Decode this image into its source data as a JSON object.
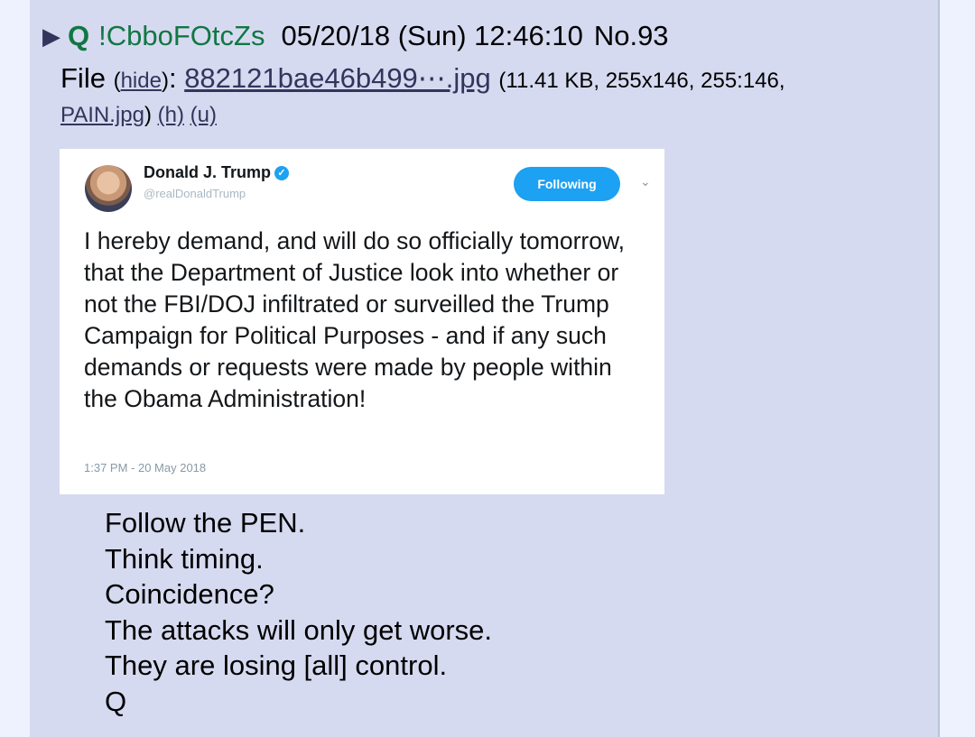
{
  "post": {
    "arrow": "▶",
    "name": "Q",
    "tripcode": "!CbboFOtcZs",
    "datetime": "05/20/18 (Sun) 12:46:10",
    "number": "No.93"
  },
  "file": {
    "label": "File",
    "hide": "hide",
    "filename": "882121bae46b499⋯.jpg",
    "meta": "(11.41 KB, 255x146, 255:146,",
    "original_name": "PAIN.jpg",
    "h": "(h)",
    "u": "(u)"
  },
  "tweet": {
    "name": "Donald J. Trump",
    "verified_icon": "✓",
    "handle": "@realDonaldTrump",
    "follow_label": "Following",
    "caret_icon": "⌄",
    "text": "I hereby demand, and will do so officially tomorrow, that the Department of Justice look into whether or not the FBI/DOJ infiltrated or surveilled the Trump Campaign for Political Purposes - and if any such demands or requests were made by people within the Obama Administration!",
    "time": "1:37 PM - 20 May 2018"
  },
  "message": [
    "Follow the PEN.",
    "Think timing.",
    "Coincidence?",
    "The attacks will only get worse.",
    "They are losing [all] control.",
    "Q"
  ],
  "colors": {
    "page_bg": "#eef2ff",
    "post_bg": "#d6daf0",
    "name_green": "#117743",
    "link": "#34345c",
    "twitter_blue": "#1da1f2"
  }
}
